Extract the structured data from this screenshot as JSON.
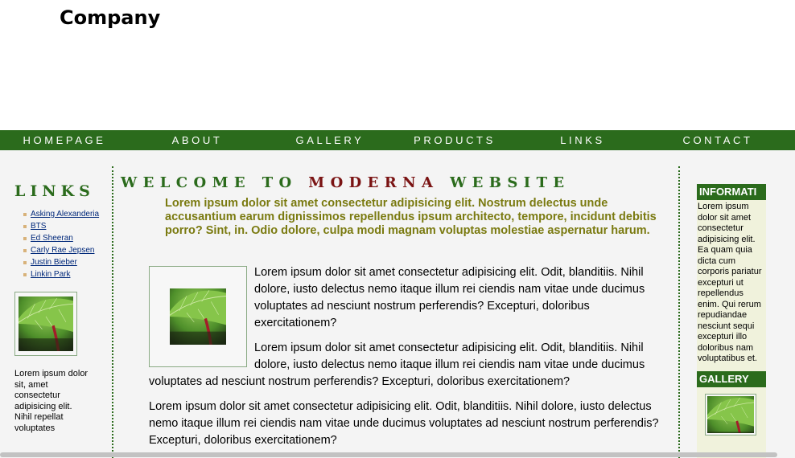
{
  "header": {
    "logo": "Company"
  },
  "nav": [
    "HOMEPAGE",
    "ABOUT",
    "GALLERY",
    "PRODUCTS",
    "LINKS",
    "CONTACT"
  ],
  "left": {
    "title": "LINKS",
    "links": [
      "Asking Alexanderia",
      "BTS",
      "Ed Sheeran",
      "Carly Rae Jepsen",
      "Justin Bieber",
      "Linkin Park"
    ],
    "text": "Lorem ipsum dolor sit, amet consectetur adipisicing elit. Nihil repellat voluptates"
  },
  "main": {
    "welcome_a": "WELCOME TO",
    "welcome_b": "MODERNA",
    "welcome_c": "WEBSITE",
    "lead": "Lorem ipsum dolor sit amet consectetur adipisicing elit. Nostrum delectus unde accusantium earum dignissimos repellendus ipsum architecto, tempore, incidunt debitis porro? Sint, in. Odio dolore, culpa modi magnam voluptas molestiae aspernatur harum.",
    "paragraphs": [
      "Lorem ipsum dolor sit amet consectetur adipisicing elit. Odit, blanditiis. Nihil dolore, iusto delectus nemo itaque illum rei ciendis nam vitae unde ducimus voluptates ad nesciunt nostrum perferendis? Excepturi, doloribus exercitationem?",
      "Lorem ipsum dolor sit amet consectetur adipisicing elit. Odit, blanditiis. Nihil dolore, iusto delectus nemo itaque illum rei ciendis nam vitae unde ducimus voluptates ad nesciunt nostrum perferendis? Excepturi, doloribus exercitationem?",
      "Lorem ipsum dolor sit amet consectetur adipisicing elit. Odit, blanditiis. Nihil dolore, iusto delectus nemo itaque illum rei ciendis nam vitae unde ducimus voluptates ad nesciunt nostrum perferendis? Excepturi, doloribus exercitationem?"
    ]
  },
  "right": {
    "info_title": "INFORMATI",
    "info_text": "Lorem ipsum dolor sit amet consectetur adipisicing elit. Ea quam quia dicta cum corporis pariatur excepturi ut repellendus enim. Qui rerum repudiandae nesciunt sequi excepturi illo doloribus nam voluptatibus et.",
    "gallery_title": "GALLERY"
  },
  "colors": {
    "brand_green": "#2b6b1c",
    "accent_red": "#7a1313",
    "lead_olive": "#7a7a10",
    "link_blue": "#00287a"
  },
  "icons": {
    "leaf_image": "leaf-thumbnail"
  }
}
